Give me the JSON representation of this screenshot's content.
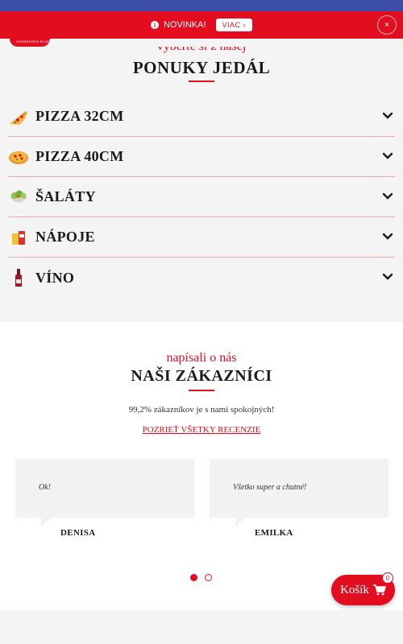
{
  "notice": {
    "text": "NOVINKA!",
    "button_label": "VIAC ›",
    "close_label": "×"
  },
  "header": {
    "logo_text": "DONÁŠKOVÁ SLUŽBA"
  },
  "menu": {
    "subtitle": "vyberte si z našej",
    "title": "PONUKY JEDÁL",
    "categories": [
      {
        "label": "PIZZA 32CM",
        "icon": "pizza-slice-icon"
      },
      {
        "label": "PIZZA 40CM",
        "icon": "pizza-whole-icon"
      },
      {
        "label": "ŠALÁTY",
        "icon": "salad-icon"
      },
      {
        "label": "NÁPOJE",
        "icon": "drinks-icon"
      },
      {
        "label": "VÍNO",
        "icon": "wine-bottle-icon"
      }
    ]
  },
  "reviews": {
    "subtitle": "napísali o nás",
    "title": "NAŠI ZÁKAZNÍCI",
    "stat": "99,2% zákazníkov je s nami spokojných!",
    "link": "POZRIEŤ VŠETKY RECENZIE",
    "items": [
      {
        "text": "Ok!",
        "author": "DENISA"
      },
      {
        "text": "Všetko super a chutné!",
        "author": "EMILKA"
      }
    ]
  },
  "cart": {
    "label": "Košík",
    "count": "0"
  },
  "colors": {
    "accent": "#e30d20",
    "top_bar": "#3b4fa8"
  }
}
